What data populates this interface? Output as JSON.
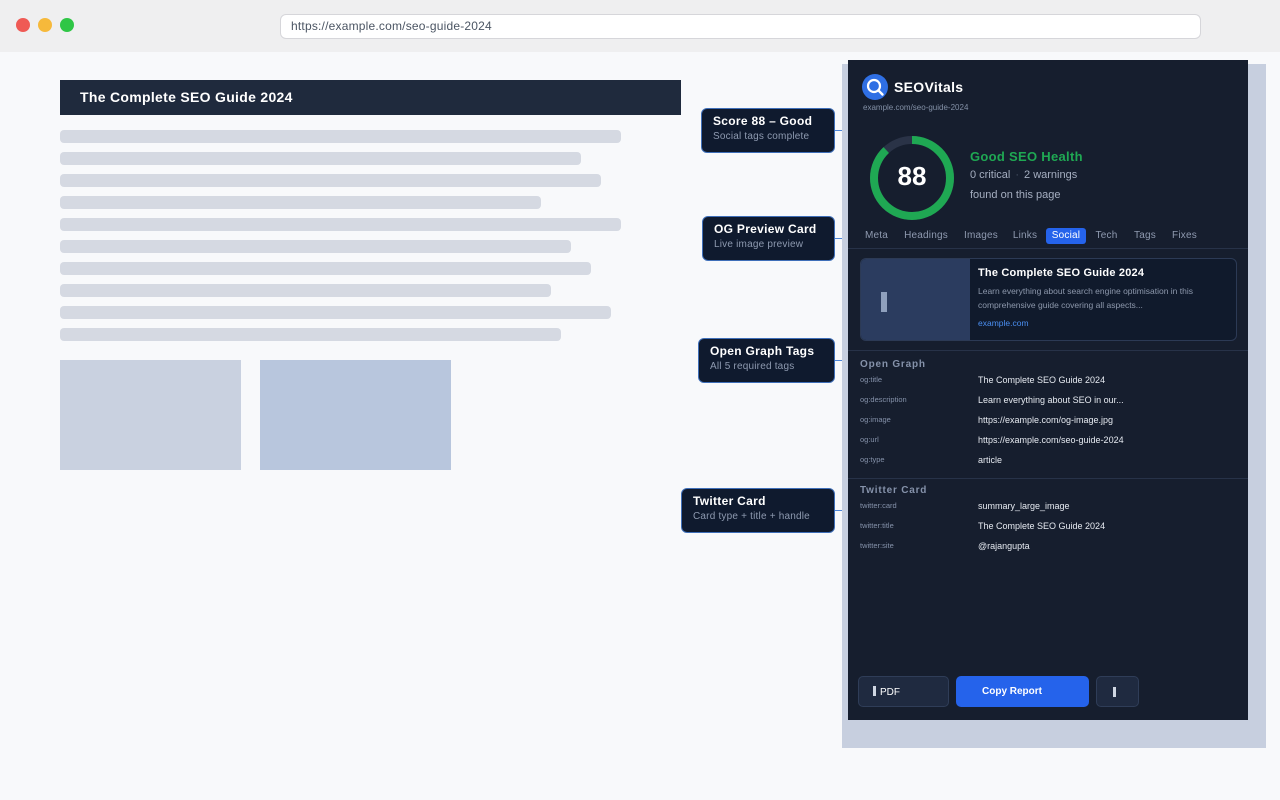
{
  "browser": {
    "url": "https://example.com/seo-guide-2024"
  },
  "page": {
    "title": "The Complete SEO Guide 2024"
  },
  "callouts": [
    {
      "title": "Score 88 – Good",
      "subtitle": "Social tags complete"
    },
    {
      "title": "OG Preview Card",
      "subtitle": "Live image preview"
    },
    {
      "title": "Open Graph Tags",
      "subtitle": "All 5 required tags"
    },
    {
      "title": "Twitter Card",
      "subtitle": "Card type + title + handle"
    }
  ],
  "extension": {
    "brand": "SEOVitals",
    "url": "example.com/seo-guide-2024",
    "score": "88",
    "score_fraction": 0.88,
    "health_title": "Good SEO Health",
    "critical": "0 critical",
    "warnings": "2 warnings",
    "found": "found on this page",
    "tabs": [
      "Meta",
      "Headings",
      "Images",
      "Links",
      "Social",
      "Tech",
      "Tags",
      "Fixes"
    ],
    "active_tab": "Social",
    "og_card": {
      "title": "The Complete SEO Guide 2024",
      "description": "Learn everything about search engine optimisation in this comprehensive guide covering all aspects...",
      "domain": "example.com"
    },
    "open_graph": {
      "heading": "Open Graph",
      "rows": [
        {
          "key": "og:title",
          "value": "The Complete SEO Guide 2024"
        },
        {
          "key": "og:description",
          "value": "Learn everything about SEO in our..."
        },
        {
          "key": "og:image",
          "value": "https://example.com/og-image.jpg"
        },
        {
          "key": "og:url",
          "value": "https://example.com/seo-guide-2024"
        },
        {
          "key": "og:type",
          "value": "article"
        }
      ]
    },
    "twitter": {
      "heading": "Twitter Card",
      "rows": [
        {
          "key": "twitter:card",
          "value": "summary_large_image"
        },
        {
          "key": "twitter:title",
          "value": "The Complete SEO Guide 2024"
        },
        {
          "key": "twitter:site",
          "value": "@rajangupta"
        }
      ]
    },
    "buttons": {
      "pdf": "PDF",
      "copy": "Copy Report"
    },
    "colors": {
      "accent": "#2563eb",
      "good": "#1fa853",
      "panel_bg": "#161e2e"
    }
  }
}
